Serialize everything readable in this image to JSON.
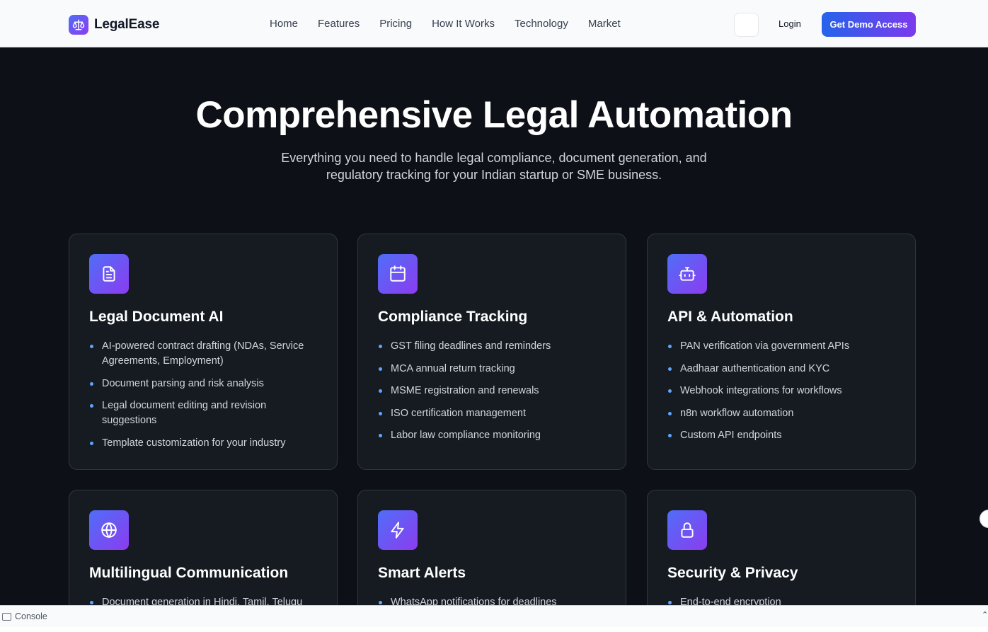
{
  "navbar": {
    "brand": "LegalEase",
    "links": [
      "Home",
      "Features",
      "Pricing",
      "How It Works",
      "Technology",
      "Market"
    ],
    "login": "Login",
    "cta": "Get Demo Access"
  },
  "hero": {
    "title": "Comprehensive Legal Automation",
    "subtitle": "Everything you need to handle legal compliance, document generation, and regulatory tracking for your Indian startup or SME business."
  },
  "cards": [
    {
      "icon": "document-icon",
      "title": "Legal Document AI",
      "items": [
        "AI-powered contract drafting (NDAs, Service Agreements, Employment)",
        "Document parsing and risk analysis",
        "Legal document editing and revision suggestions",
        "Template customization for your industry"
      ]
    },
    {
      "icon": "calendar-icon",
      "title": "Compliance Tracking",
      "items": [
        "GST filing deadlines and reminders",
        "MCA annual return tracking",
        "MSME registration and renewals",
        "ISO certification management",
        "Labor law compliance monitoring"
      ]
    },
    {
      "icon": "bot-icon",
      "title": "API & Automation",
      "items": [
        "PAN verification via government APIs",
        "Aadhaar authentication and KYC",
        "Webhook integrations for workflows",
        "n8n workflow automation",
        "Custom API endpoints"
      ]
    },
    {
      "icon": "globe-icon",
      "title": "Multilingual Communication",
      "items": [
        "Document generation in Hindi, Tamil, Telugu"
      ]
    },
    {
      "icon": "lightning-icon",
      "title": "Smart Alerts",
      "items": [
        "WhatsApp notifications for deadlines"
      ]
    },
    {
      "icon": "lock-icon",
      "title": "Security & Privacy",
      "items": [
        "End-to-end encryption"
      ]
    }
  ],
  "devtools": {
    "console_label": "Console"
  }
}
